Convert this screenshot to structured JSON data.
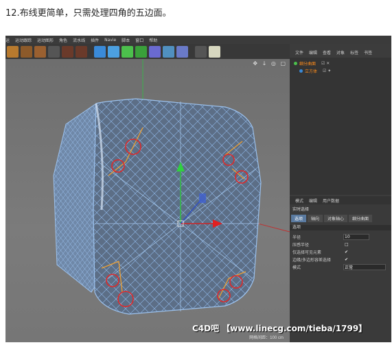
{
  "caption": "12.布线更简单，只需处理四角的五边面。",
  "menu": [
    "运",
    "运动跟踪",
    "运动图形",
    "角色",
    "流水线",
    "插件",
    "Navie",
    "脚本",
    "窗口",
    "帮助"
  ],
  "toolbar_icons": [
    {
      "name": "render-icon",
      "color": "#b87a2e"
    },
    {
      "name": "render-settings-icon",
      "color": "#8c5a2a"
    },
    {
      "name": "render-view-icon",
      "color": "#9a6030"
    },
    {
      "name": "clapper-icon",
      "color": "#555555"
    },
    {
      "name": "clapper-pv-icon",
      "color": "#6a3a2a"
    },
    {
      "name": "clapper-edit-icon",
      "color": "#6a3a2a"
    },
    {
      "name": "cube-icon",
      "color": "#3a8ad8"
    },
    {
      "name": "pen-icon",
      "color": "#4ca0e0"
    },
    {
      "name": "subdivide-icon",
      "color": "#4cc04c"
    },
    {
      "name": "array-icon",
      "color": "#3aa03a"
    },
    {
      "name": "deformer-icon",
      "color": "#6a6ad0"
    },
    {
      "name": "floor-icon",
      "color": "#5090c0"
    },
    {
      "name": "capsule-icon",
      "color": "#6a7ac8"
    },
    {
      "name": "camera-icon",
      "color": "#555555"
    },
    {
      "name": "light-icon",
      "color": "#d8d8c0"
    }
  ],
  "viewport_icons": "✥ ↓ ◎ ▢",
  "object_manager": {
    "tabs": [
      "文件",
      "编辑",
      "查看",
      "对象",
      "标签",
      "书签"
    ],
    "rows": [
      {
        "label": "细分曲面",
        "color": "#4cc04c"
      },
      {
        "label": "立方体",
        "color": "#3a8ad8"
      }
    ]
  },
  "attribute_manager": {
    "tabs": [
      "模式",
      "编辑",
      "用户数据"
    ],
    "title": "实时选择",
    "subtabs": [
      "选项",
      "轴向",
      "对象轴心",
      "细分曲面"
    ],
    "section": "选项",
    "params": [
      {
        "label": "半径",
        "value": "10"
      },
      {
        "label": "压感半径",
        "value": "□"
      },
      {
        "label": "仅选择可见元素",
        "value": "✔"
      },
      {
        "label": "边缘/多边形容差选择",
        "value": "✔"
      },
      {
        "label": "模式",
        "value": "正常"
      }
    ]
  },
  "watermark": "C4D吧 【www.linecg.com/tieba/1799】",
  "grid_label": "网格间距：100 cm"
}
